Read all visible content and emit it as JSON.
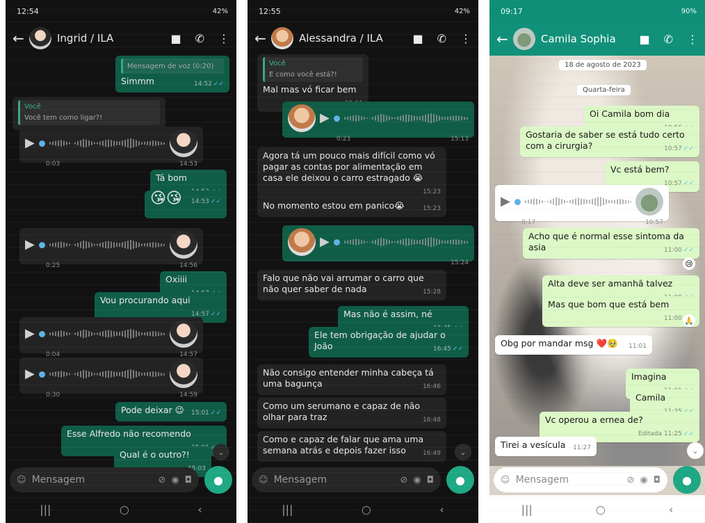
{
  "screens": [
    {
      "status": {
        "time": "12:54",
        "right": "42%"
      },
      "header": {
        "name": "Ingrid / ILA"
      },
      "messages": {
        "m1_quote": "Mensagem de voz (0:20)",
        "m1_text": "Simmm",
        "m1_time": "14:52",
        "m2_author": "Você",
        "m2_quote": "Você tem como ligar?!",
        "v1_dur": "0:03",
        "v1_time": "14:53",
        "m3_text": "Tá bom",
        "m3_time": "14:53",
        "m4_text": "😘😘",
        "m4_time": "14:53",
        "v2_dur": "0:25",
        "v2_time": "14:56",
        "m5_text": "Oxiiii",
        "m5_time": "14:57",
        "m6_text": "Vou procurando aqui",
        "m6_time": "14:57",
        "v3_dur": "0:04",
        "v3_time": "14:57",
        "v4_dur": "0:30",
        "v4_time": "14:59",
        "m7_text": "Pode deixar 😉",
        "m7_time": "15:01",
        "m8_text": "Esse Alfredo não recomendo",
        "m8_time": "15:01",
        "m9_text": "Qual é o outro?!",
        "m9_time": "15:03"
      },
      "input": {
        "placeholder": "Mensagem"
      }
    },
    {
      "status": {
        "time": "12:55",
        "right": "42%"
      },
      "header": {
        "name": "Alessandra / ILA"
      },
      "messages": {
        "q_author": "Você",
        "q_text": "E como você está?!",
        "m1_text": "Mal mas vó ficar bem",
        "m1_time": "15:11",
        "v1_dur": "0:23",
        "v1_time": "15:13",
        "m2_text": "Agora tá um pouco mais difícil como vó pagar as contas por alimentação em casa ele deixou o carro estragado 😭",
        "m2_time": "15:23",
        "m3_text": "No momento estou em panico😭",
        "m3_time": "15:23",
        "v2_time": "15:24",
        "m4_text": "Falo que não vai arrumar o carro que não quer saber de nada",
        "m4_time": "15:28",
        "m5_text": "Mas não é assim, né",
        "m5_time": "16:45",
        "m6_text": "Ele tem obrigação de ajudar o João",
        "m6_time": "16:45",
        "m7_text": "Não consigo entender minha cabeça tá uma bagunça",
        "m7_time": "16:46",
        "m8_text": "Como um serumano e capaz de não olhar para traz",
        "m8_time": "16:48",
        "m9_text": "Como e capaz de falar que ama uma semana atrás e depois fazer isso",
        "m9_time": "16:49"
      },
      "input": {
        "placeholder": "Mensagem"
      }
    },
    {
      "status": {
        "time": "09:17",
        "right": "90%"
      },
      "header": {
        "name": "Camila Sophia"
      },
      "messages": {
        "date1": "18 de agosto de 2023",
        "date2": "Quarta-feira",
        "m1_text": "Oi Camila bom dia",
        "m1_time": "10:56",
        "m2_text": "Gostaria de saber se está tudo certo com a cirurgia?",
        "m2_time": "10:57",
        "m3_text": "Vc está bem?",
        "m3_time": "10:57",
        "v1_dur": "0:17",
        "v1_time": "10:57",
        "m4_text": "Acho que é normal esse sintoma da asia",
        "m4_time": "11:00",
        "m5_text": "Alta deve ser amanhã talvez",
        "m5_time": "11:00",
        "m6_text": "Mas que bom que está bem",
        "m6_time": "11:00",
        "m7_text": "Obg por mandar msg ❤️🥹",
        "m7_time": "11:01",
        "m8_text": "Imagina",
        "m8_time": "11:01",
        "m9_text": "Camila",
        "m9_time": "11:25",
        "m10_text": "Vc operou a ernea de?",
        "m10_time": "Editada 11:25",
        "m11_text": "Tirei a vesícula",
        "m11_time": "11:27"
      },
      "input": {
        "placeholder": "Mensagem"
      }
    }
  ]
}
